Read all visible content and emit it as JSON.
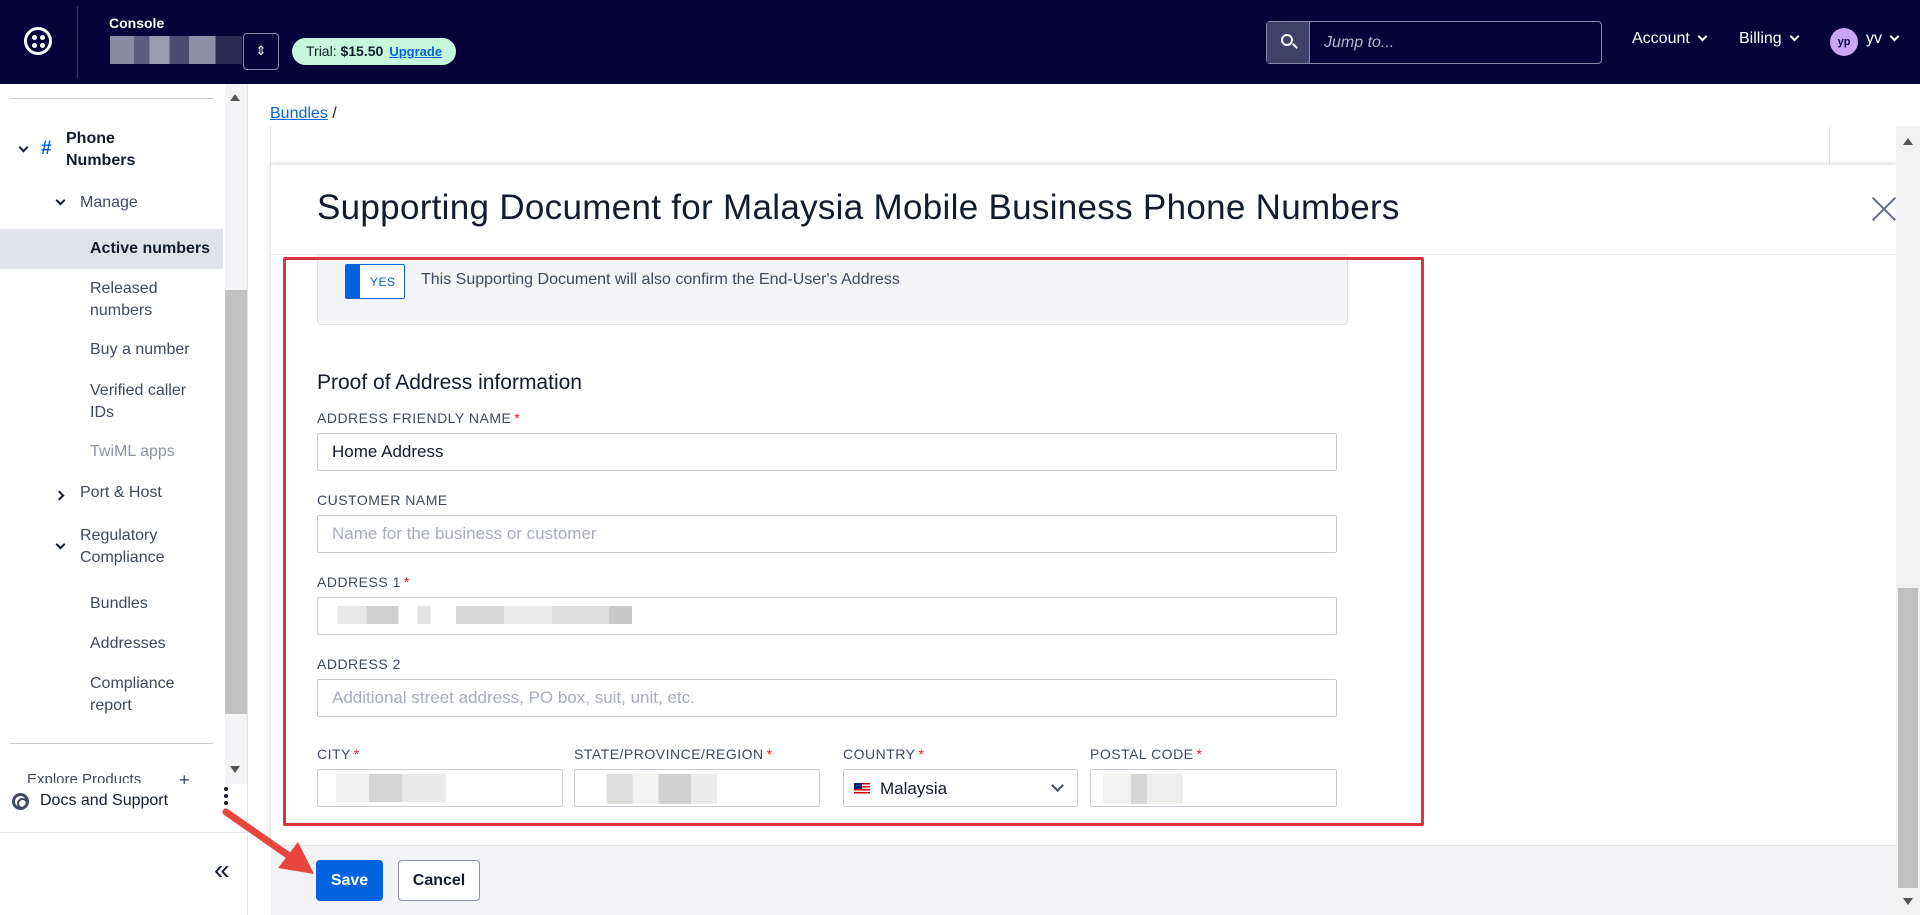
{
  "topbar": {
    "console_label": "Console",
    "trial_prefix": "Trial: ",
    "trial_amount": "$15.50",
    "upgrade_label": "Upgrade",
    "search_placeholder": "Jump to...",
    "account_label": "Account",
    "billing_label": "Billing",
    "avatar_initials": "yp",
    "user_label": "yv"
  },
  "sidebar": {
    "phone_numbers": "Phone Numbers",
    "manage": "Manage",
    "active_numbers": "Active numbers",
    "released_numbers": "Released numbers",
    "buy_number": "Buy a number",
    "verified_caller_ids": "Verified caller IDs",
    "twiml_apps": "TwiML apps",
    "port_host": "Port & Host",
    "regulatory_compliance": "Regulatory Compliance",
    "bundles": "Bundles",
    "addresses": "Addresses",
    "compliance_report": "Compliance report",
    "explore_products": "Explore Products",
    "docs_support": "Docs and Support"
  },
  "breadcrumb": {
    "bundles_link": "Bundles",
    "separator": "/"
  },
  "modal": {
    "title": "Supporting Document for Malaysia Mobile Business Phone Numbers",
    "toggle_label": "YES",
    "toggle_text": "This Supporting Document will also confirm the End-User's Address",
    "section_title": "Proof of Address information",
    "fields": {
      "friendly_name_label": "ADDRESS FRIENDLY NAME",
      "friendly_name_value": "Home Address",
      "customer_name_label": "CUSTOMER NAME",
      "customer_name_placeholder": "Name for the business or customer",
      "address1_label": "ADDRESS 1",
      "address2_label": "ADDRESS 2",
      "address2_placeholder": "Additional street address, PO box, suit, unit, etc.",
      "city_label": "CITY",
      "state_label": "STATE/PROVINCE/REGION",
      "country_label": "COUNTRY",
      "country_value": "Malaysia",
      "postal_label": "POSTAL CODE",
      "required_mark": "*"
    },
    "save_label": "Save",
    "cancel_label": "Cancel"
  },
  "colors": {
    "topbar_bg": "#06033a",
    "primary": "#0263e0",
    "highlight_frame": "#d9343f",
    "trial_badge": "#c6f7dc"
  }
}
